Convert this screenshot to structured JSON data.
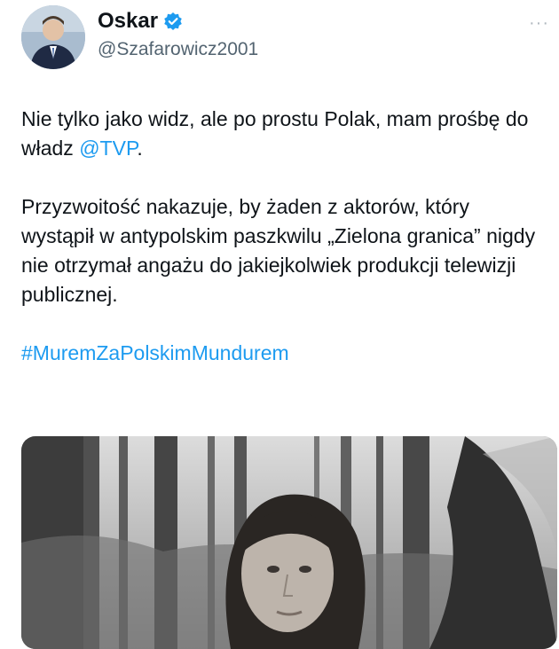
{
  "user": {
    "display_name": "Oskar",
    "handle": "@Szafarowicz2001",
    "verified_icon": "verified-badge-icon",
    "verified_color": "#1d9bf0"
  },
  "more_icon": "more-dots-icon",
  "tweet": {
    "para1_prefix": "Nie tylko jako widz, ale po prostu Polak, mam prośbę do władz ",
    "para1_mention": "@TVP",
    "para1_suffix": ".",
    "para2": "Przyzwoitość nakazuje, by żaden z aktorów, który wystąpił w antypolskim paszkwilu „Zielona granica” nigdy nie otrzymał angażu do jakiejkolwiek produkcji telewizji publicznej.",
    "hashtag": "#MuremZaPolskimMundurem"
  },
  "colors": {
    "text": "#0f1419",
    "secondary": "#536471",
    "link": "#1d9bf0"
  }
}
